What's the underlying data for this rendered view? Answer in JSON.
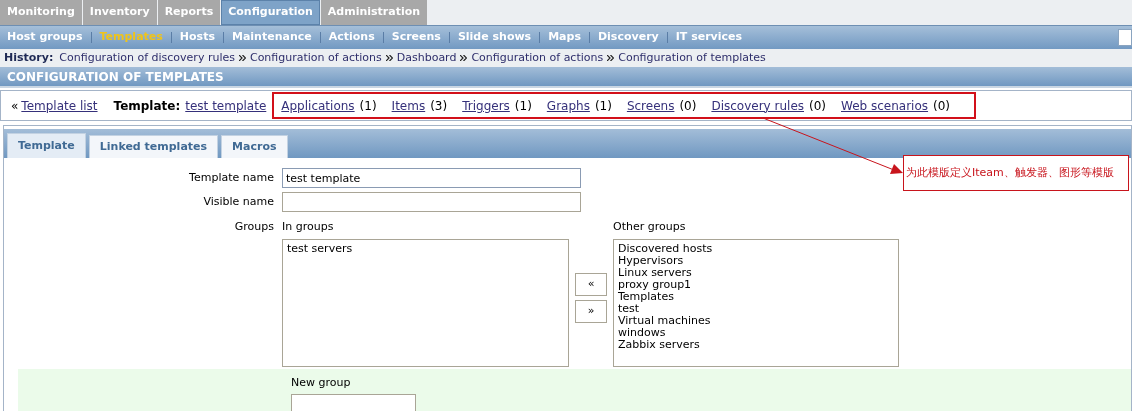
{
  "main_menu": [
    {
      "label": "Monitoring",
      "selected": false
    },
    {
      "label": "Inventory",
      "selected": false
    },
    {
      "label": "Reports",
      "selected": false
    },
    {
      "label": "Configuration",
      "selected": true
    },
    {
      "label": "Administration",
      "selected": false
    }
  ],
  "sub_menu": [
    {
      "label": "Host groups",
      "selected": false
    },
    {
      "label": "Templates",
      "selected": true
    },
    {
      "label": "Hosts",
      "selected": false
    },
    {
      "label": "Maintenance",
      "selected": false
    },
    {
      "label": "Actions",
      "selected": false
    },
    {
      "label": "Screens",
      "selected": false
    },
    {
      "label": "Slide shows",
      "selected": false
    },
    {
      "label": "Maps",
      "selected": false
    },
    {
      "label": "Discovery",
      "selected": false
    },
    {
      "label": "IT services",
      "selected": false
    }
  ],
  "history": {
    "label": "History:",
    "items": [
      "Configuration of discovery rules",
      "Configuration of actions",
      "Dashboard",
      "Configuration of actions",
      "Configuration of templates"
    ]
  },
  "page_title": "CONFIGURATION OF TEMPLATES",
  "navigation": {
    "back_icon": "«",
    "back_link": "Template list",
    "template_label": "Template:",
    "template_link": "test template",
    "links": [
      {
        "label": "Applications",
        "count": "(1)"
      },
      {
        "label": "Items",
        "count": "(3)"
      },
      {
        "label": "Triggers",
        "count": "(1)"
      },
      {
        "label": "Graphs",
        "count": "(1)"
      },
      {
        "label": "Screens",
        "count": "(0)"
      },
      {
        "label": "Discovery rules",
        "count": "(0)"
      },
      {
        "label": "Web scenarios",
        "count": "(0)"
      }
    ]
  },
  "tabs": [
    {
      "label": "Template",
      "selected": true
    },
    {
      "label": "Linked templates",
      "selected": false
    },
    {
      "label": "Macros",
      "selected": false
    }
  ],
  "form": {
    "template_name": {
      "label": "Template name",
      "value": "test template"
    },
    "visible_name": {
      "label": "Visible name"
    },
    "groups": {
      "label": "Groups",
      "in_groups": {
        "label": "In groups",
        "items": [
          "test servers"
        ]
      },
      "other_groups": {
        "label": "Other groups",
        "items": [
          "Discovered hosts",
          "Hypervisors",
          "Linux servers",
          "proxy group1",
          "Templates",
          "test",
          "Virtual machines",
          "windows",
          "Zabbix servers"
        ]
      },
      "move_left": "«",
      "move_right": "»"
    },
    "new_group": {
      "label": "New group"
    }
  },
  "annotation": {
    "text": "为此模版定义Iteam、触发器、图形等模版"
  }
}
